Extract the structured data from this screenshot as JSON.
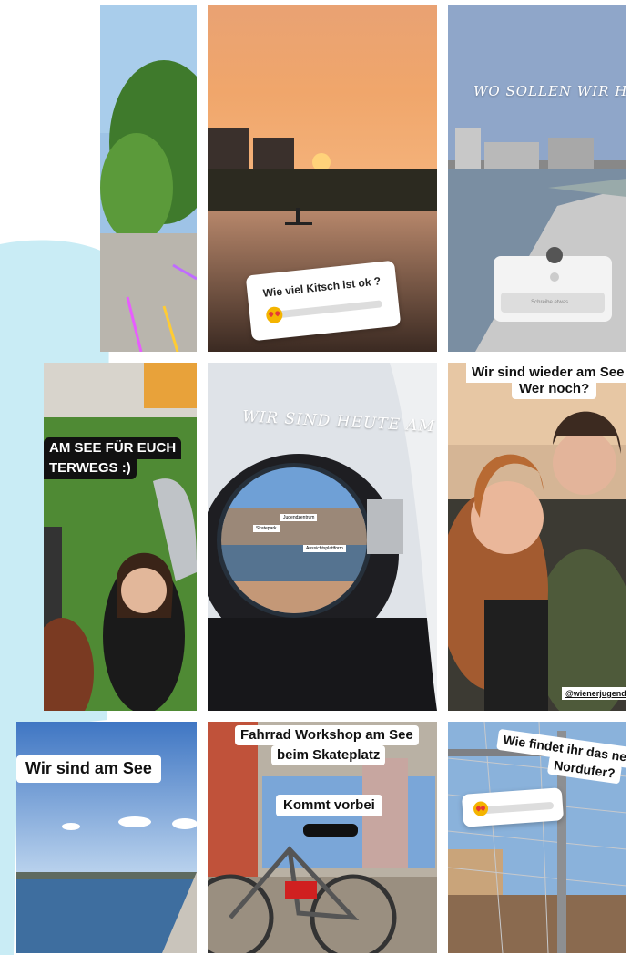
{
  "tiles": {
    "t2": {
      "slider_question": "Wie viel Kitsch ist ok ?"
    },
    "t3": {
      "handwritten": "WO SOLLEN WIR HEUTE HINKOM",
      "input_placeholder": "Schreibe etwas ..."
    },
    "t4": {
      "caption_line1": "AM SEE FÜR EUCH",
      "caption_line2": "TERWEGS :)"
    },
    "t5": {
      "handwritten": "WIR SIND HEUTE AM SEE",
      "sign1": "Jugendzentrum",
      "sign2": "Skatepark",
      "sign3": "Aussichtsplattform"
    },
    "t6": {
      "caption_line1": "Wir sind wieder am See",
      "caption_line2": "Wer noch?",
      "handle": "@wienerjugendz"
    },
    "t7": {
      "caption": "Wir sind am See"
    },
    "t8": {
      "caption_line1": "Fahrrad Workshop am See",
      "caption_line2": "beim Skateplatz",
      "caption2": "Kommt vorbei"
    },
    "t9": {
      "caption_line1": "Wie findet ihr das ne",
      "caption_line2": "Nordufer?"
    }
  },
  "colors": {
    "blob_blue": "#c9ecf5"
  }
}
